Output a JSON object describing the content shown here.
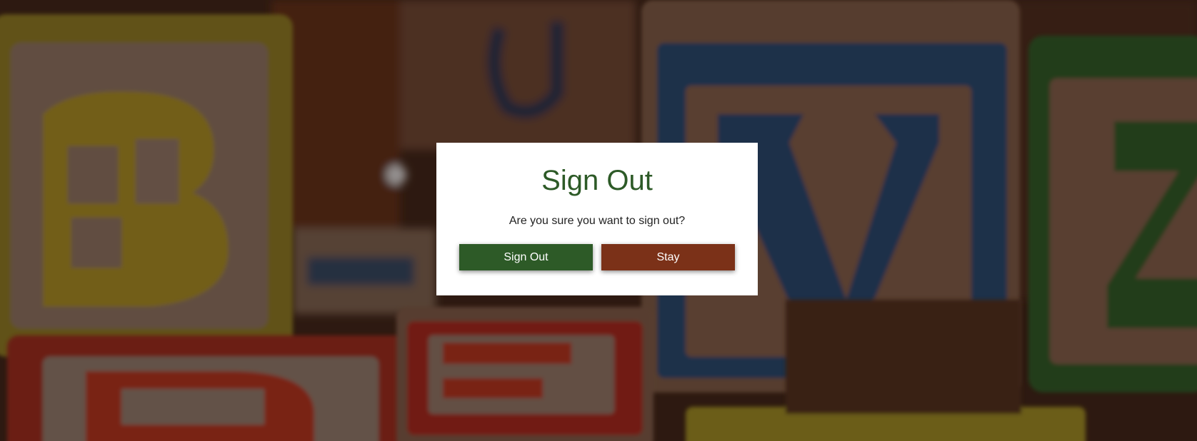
{
  "background": {
    "description_icon": "alphabet-blocks-photo",
    "block_letters": [
      "B",
      "V",
      "Z",
      "D",
      "E"
    ]
  },
  "dialog": {
    "title": "Sign Out",
    "message": "Are you sure you want to sign out?",
    "confirm_label": "Sign Out",
    "cancel_label": "Stay",
    "colors": {
      "title": "#2d5a27",
      "confirm": "#2d5a27",
      "cancel": "#7b3118"
    }
  }
}
